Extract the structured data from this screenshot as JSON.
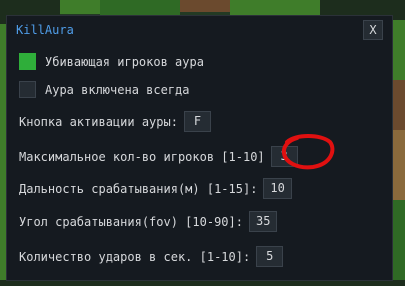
{
  "window": {
    "title": "KillAura",
    "close_label": "X"
  },
  "options": [
    {
      "label": "Убивающая игроков аура",
      "checked": true
    },
    {
      "label": "Аура включена всегда",
      "checked": false
    }
  ],
  "settings": [
    {
      "label": "Кнопка активации ауры:",
      "value": "F"
    },
    {
      "label": "Максимальное кол-во игроков [1-10]",
      "value": "3"
    },
    {
      "label": "Дальность срабатывания(м) [1-15]:",
      "value": "10"
    },
    {
      "label": "Угол срабатывания(fov) [10-90]:",
      "value": "35"
    },
    {
      "label": "Количество ударов в сек. [1-10]:",
      "value": "5"
    }
  ],
  "colors": {
    "accent": "#4f9de8",
    "checked": "#2fae3a",
    "annotation": "#e01010"
  }
}
